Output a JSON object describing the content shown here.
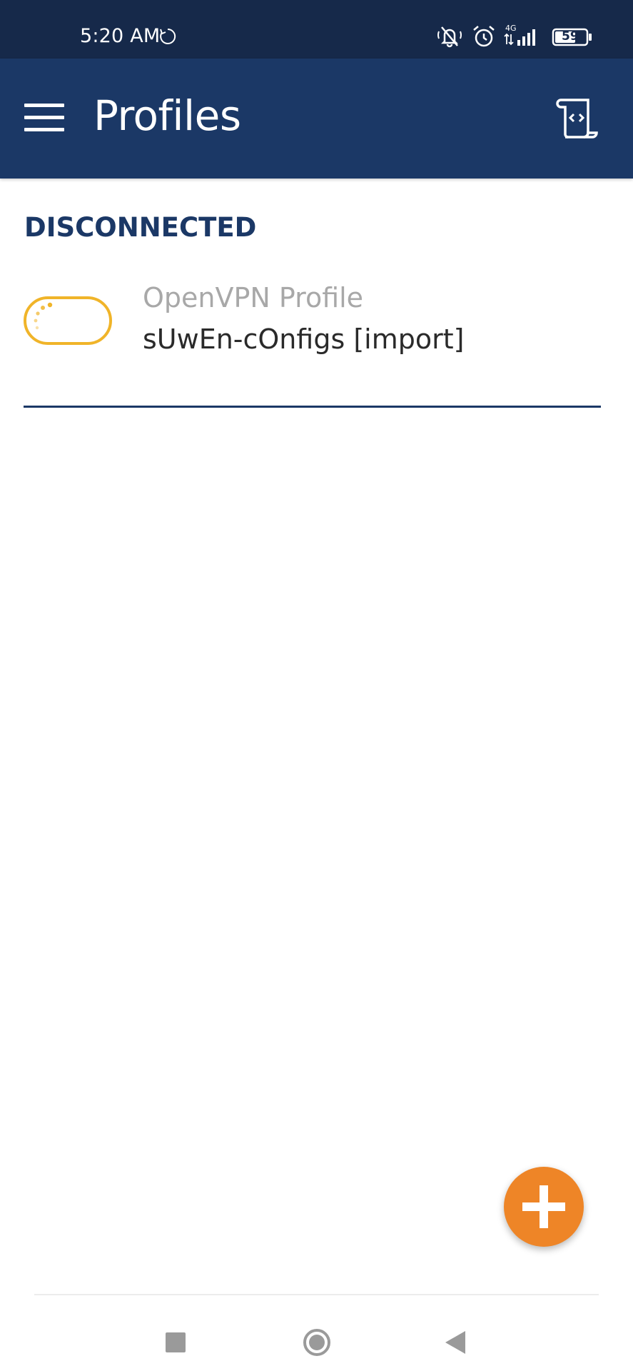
{
  "status_bar": {
    "time": "5:20 AM",
    "network": "4G",
    "battery_level": "59",
    "icons": [
      "sync-icon",
      "muted-bell-icon",
      "alarm-icon",
      "signal-icon",
      "battery-icon"
    ]
  },
  "app_bar": {
    "title": "Profiles",
    "menu_icon": "hamburger-menu-icon",
    "action_icon": "log-scroll-icon"
  },
  "section": {
    "header": "DISCONNECTED"
  },
  "profiles": [
    {
      "type": "OpenVPN Profile",
      "name": "sUwEn-cOnfigs [import]",
      "toggle_state": "disconnected",
      "toggle_color": "#f0b429"
    }
  ],
  "fab": {
    "icon": "plus-icon",
    "color": "#ee8527"
  },
  "nav_bar": {
    "icons": [
      "recents-square-icon",
      "home-circle-icon",
      "back-triangle-icon"
    ]
  },
  "colors": {
    "status_bar": "#16294a",
    "app_bar": "#1b3866",
    "accent": "#ee8527",
    "section_header": "#1b3866"
  }
}
